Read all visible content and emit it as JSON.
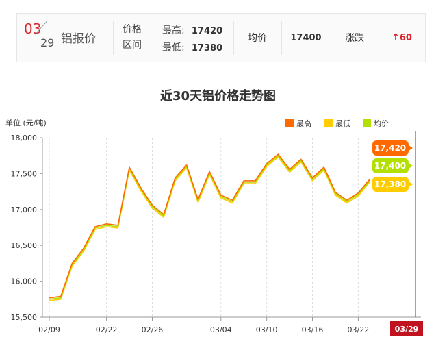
{
  "header": {
    "month": "03",
    "day": "29",
    "metal_name": "铝报价",
    "range_label_1": "价格",
    "range_label_2": "区间",
    "high_label": "最高:",
    "high_value": "17420",
    "low_label": "最低:",
    "low_value": "17380",
    "avg_label": "均价",
    "avg_value": "17400",
    "change_label": "涨跌",
    "change_arrow": "↑",
    "change_value": "60"
  },
  "colors": {
    "high": "#ff6a00",
    "low": "#ffcc00",
    "avg": "#b3e000",
    "accent_red": "#c1121f"
  },
  "chart_data": {
    "type": "line",
    "title": "近30天铝价格走势图",
    "ylabel": "单位 (元/吨)",
    "ylim": [
      15500,
      18000
    ],
    "yticks": [
      15500,
      16000,
      16500,
      17000,
      17500,
      18000
    ],
    "ytick_labels": [
      "15,500",
      "16,000",
      "16,500",
      "17,000",
      "17,500",
      "18,000"
    ],
    "xtick_labels": [
      "02/09",
      "02/22",
      "02/26",
      "03/04",
      "03/10",
      "03/16",
      "03/22",
      "03/29"
    ],
    "legend": [
      {
        "name": "最高",
        "color": "#ff6a00"
      },
      {
        "name": "最低",
        "color": "#ffcc00"
      },
      {
        "name": "均价",
        "color": "#b3e000"
      }
    ],
    "x": [
      "02/09",
      "02/10",
      "02/11",
      "02/12",
      "02/13",
      "02/22",
      "02/23",
      "02/24",
      "02/25",
      "02/26",
      "02/27",
      "02/28",
      "03/01",
      "03/02",
      "03/03",
      "03/04",
      "03/07",
      "03/08",
      "03/09",
      "03/10",
      "03/11",
      "03/14",
      "03/15",
      "03/16",
      "03/17",
      "03/18",
      "03/21",
      "03/22",
      "03/23",
      "03/24",
      "03/25",
      "03/28",
      "03/29"
    ],
    "series": [
      {
        "name": "最高",
        "values": [
          15770,
          15790,
          16250,
          16460,
          16760,
          16800,
          16780,
          17590,
          17300,
          17060,
          16930,
          17440,
          17620,
          17140,
          17530,
          17200,
          17130,
          17400,
          17400,
          17640,
          17770,
          17560,
          17700,
          17440,
          17590,
          17240,
          17130,
          17230,
          17420
        ]
      },
      {
        "name": "最低",
        "values": [
          15730,
          15750,
          16210,
          16420,
          16720,
          16760,
          16740,
          17550,
          17260,
          17020,
          16890,
          17400,
          17580,
          17100,
          17490,
          17160,
          17090,
          17360,
          17360,
          17600,
          17730,
          17520,
          17660,
          17400,
          17550,
          17200,
          17090,
          17190,
          17380
        ]
      },
      {
        "name": "均价",
        "values": [
          15750,
          15770,
          16230,
          16440,
          16740,
          16780,
          16760,
          17570,
          17280,
          17040,
          16910,
          17420,
          17600,
          17120,
          17510,
          17180,
          17110,
          17380,
          17380,
          17620,
          17750,
          17540,
          17680,
          17420,
          17570,
          17220,
          17110,
          17210,
          17400
        ]
      }
    ],
    "end_labels": {
      "high": "17,420",
      "avg": "17,400",
      "low": "17,380"
    },
    "current_date": "03/29"
  }
}
